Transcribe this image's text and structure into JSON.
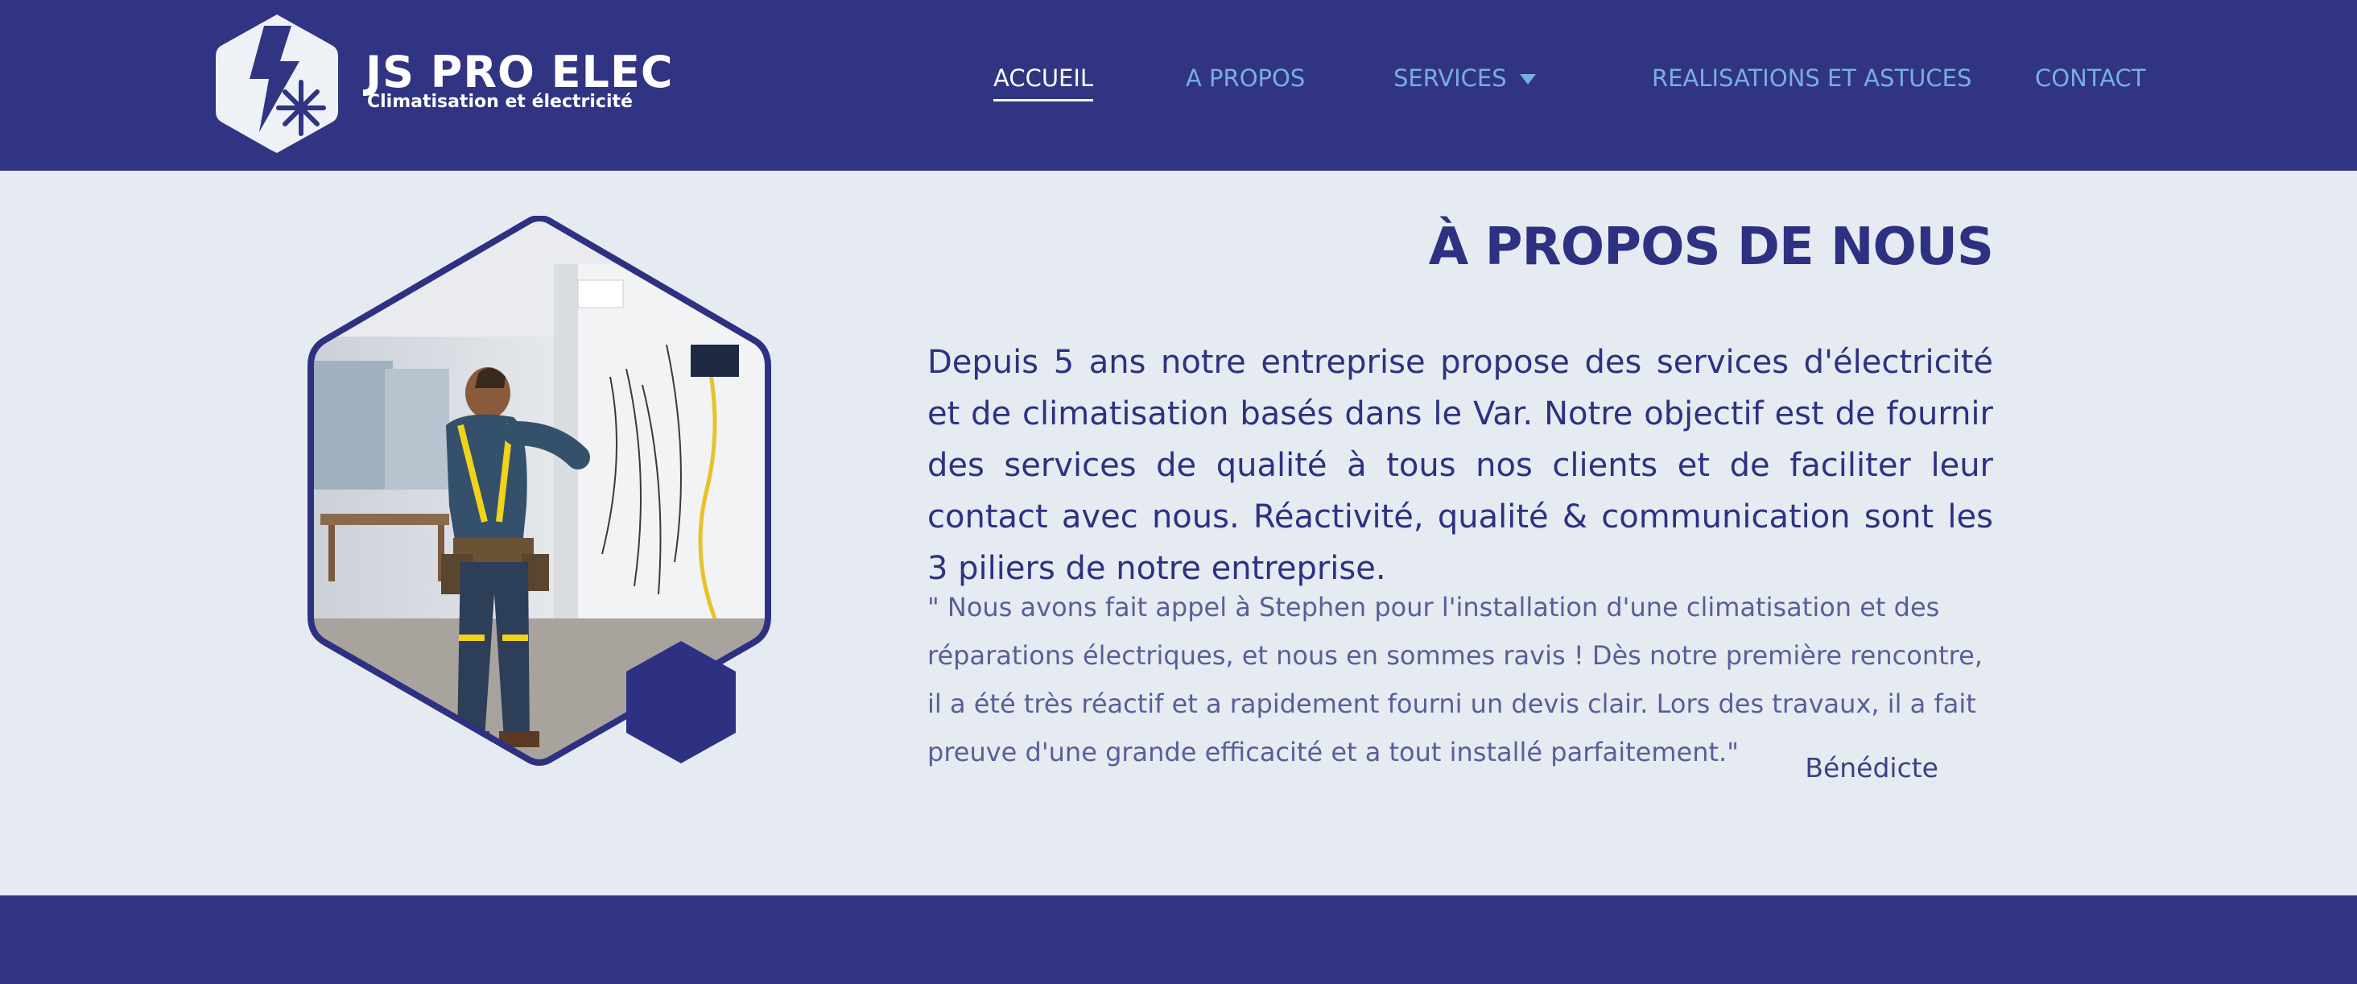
{
  "brand": {
    "name": "JS PRO ELEC",
    "tagline": "Climatisation et électricité"
  },
  "nav": {
    "items": [
      {
        "label": "ACCUEIL",
        "active": true
      },
      {
        "label": "A PROPOS",
        "active": false
      },
      {
        "label": "SERVICES",
        "active": false
      },
      {
        "label": "REALISATIONS ET ASTUCES",
        "active": false
      },
      {
        "label": "CONTACT",
        "active": false
      }
    ]
  },
  "about": {
    "title": "À PROPOS DE NOUS",
    "intro": "Depuis 5 ans notre entreprise propose des services d'électricité et de climatisation basés dans le Var. Notre objectif est de fournir des services de qualité à tous nos clients et de faciliter leur contact avec nous. Réactivité, qualité & communication sont les 3 piliers de notre entreprise.",
    "testimonial": "\" Nous avons fait appel à Stephen pour l'installation d'une climatisation et des réparations électriques, et nous en sommes ravis ! Dès notre première rencontre, il a été très réactif et a rapidement fourni un devis clair. Lors des travaux, il a fait preuve d'une grande efficacité et a tout installé parfaitement.\"",
    "author": "Bénédicte"
  },
  "colors": {
    "primary": "#313482",
    "background": "#e5ebf0",
    "nav_link": "#78aee2",
    "text": "#2e3182"
  },
  "icons": {
    "logo": "lightning-snowflake-hexagon-icon",
    "dropdown": "caret-down-icon"
  }
}
